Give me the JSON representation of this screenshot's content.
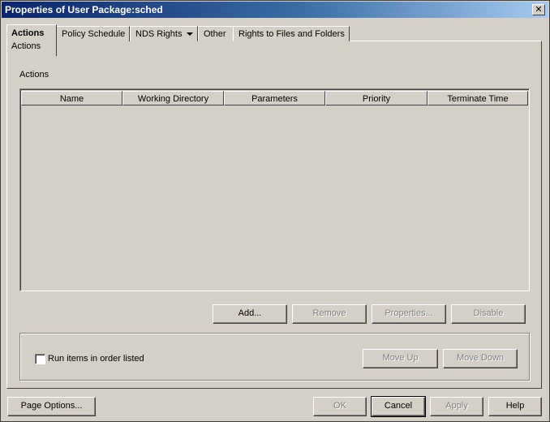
{
  "window": {
    "title": "Properties of User Package:sched"
  },
  "tabs": [
    {
      "label": "Actions",
      "sublabel": "Actions"
    },
    {
      "label": "Policy Schedule"
    },
    {
      "label": "NDS Rights"
    },
    {
      "label": "Other"
    },
    {
      "label": "Rights to Files and Folders"
    }
  ],
  "actions": {
    "section_label": "Actions",
    "columns": [
      "Name",
      "Working Directory",
      "Parameters",
      "Priority",
      "Terminate Time"
    ],
    "rows": [],
    "buttons": {
      "add": "Add...",
      "remove": "Remove",
      "properties": "Properties...",
      "disable": "Disable"
    }
  },
  "order": {
    "checkbox_label": "Run items in order listed",
    "checked": false,
    "move_up": "Move Up",
    "move_down": "Move Down"
  },
  "footer": {
    "page_options": "Page Options...",
    "ok": "OK",
    "cancel": "Cancel",
    "apply": "Apply",
    "help": "Help"
  }
}
